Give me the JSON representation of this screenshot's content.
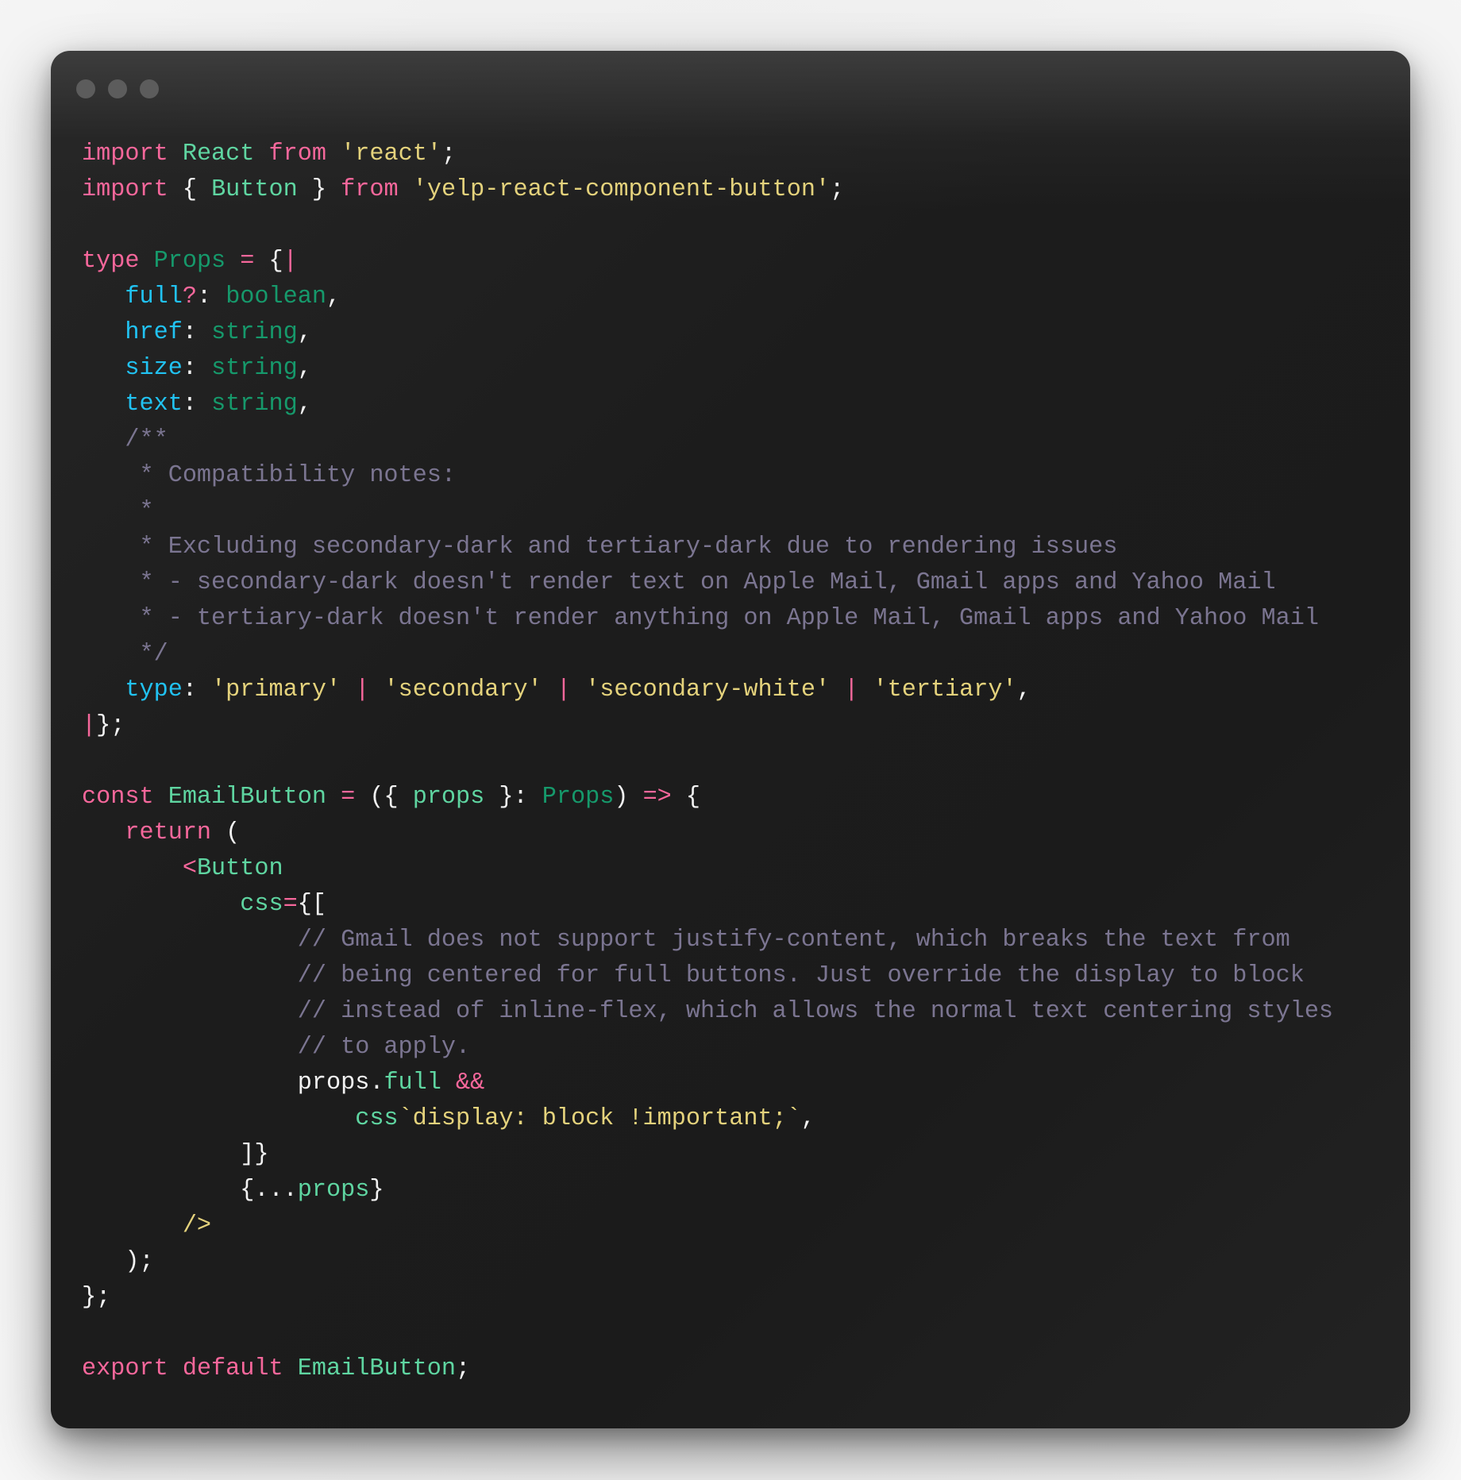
{
  "window": {
    "controls": [
      {
        "name": "close",
        "icon": "window-dot-icon"
      },
      {
        "name": "minimize",
        "icon": "window-dot-icon"
      },
      {
        "name": "zoom",
        "icon": "window-dot-icon"
      }
    ]
  },
  "colors": {
    "keyword": "#f6679b",
    "identifier": "#5fd5a1",
    "type": "#16996b",
    "string": "#e4d27c",
    "property": "#21c2f2",
    "comment": "#7b7591",
    "punctuation": "#f2f2f2",
    "window_background": "#1c1c1c"
  },
  "code": {
    "language": "javascript-flow-jsx",
    "lines": [
      {
        "indent": 0,
        "tokens": [
          [
            "import",
            "kw"
          ],
          [
            " ",
            "pn"
          ],
          [
            "React",
            "id"
          ],
          [
            " ",
            "pn"
          ],
          [
            "from",
            "kw"
          ],
          [
            " ",
            "pn"
          ],
          [
            "'react'",
            "str"
          ],
          [
            ";",
            "pn"
          ]
        ]
      },
      {
        "indent": 0,
        "tokens": [
          [
            "import",
            "kw"
          ],
          [
            " { ",
            "pn"
          ],
          [
            "Button",
            "id"
          ],
          [
            " } ",
            "pn"
          ],
          [
            "from",
            "kw"
          ],
          [
            " ",
            "pn"
          ],
          [
            "'yelp-react-component-button'",
            "str"
          ],
          [
            ";",
            "pn"
          ]
        ]
      },
      {
        "indent": 0,
        "tokens": []
      },
      {
        "indent": 0,
        "tokens": [
          [
            "type",
            "kw"
          ],
          [
            " ",
            "pn"
          ],
          [
            "Props",
            "ty"
          ],
          [
            " ",
            "pn"
          ],
          [
            "=",
            "kw"
          ],
          [
            " {",
            "pn"
          ],
          [
            "|",
            "pipe"
          ]
        ]
      },
      {
        "indent": 3,
        "tokens": [
          [
            "full",
            "prop"
          ],
          [
            "?",
            "kw"
          ],
          [
            ": ",
            "pn"
          ],
          [
            "boolean",
            "ty"
          ],
          [
            ",",
            "pn"
          ]
        ]
      },
      {
        "indent": 3,
        "tokens": [
          [
            "href",
            "prop"
          ],
          [
            ": ",
            "pn"
          ],
          [
            "string",
            "ty"
          ],
          [
            ",",
            "pn"
          ]
        ]
      },
      {
        "indent": 3,
        "tokens": [
          [
            "size",
            "prop"
          ],
          [
            ": ",
            "pn"
          ],
          [
            "string",
            "ty"
          ],
          [
            ",",
            "pn"
          ]
        ]
      },
      {
        "indent": 3,
        "tokens": [
          [
            "text",
            "prop"
          ],
          [
            ": ",
            "pn"
          ],
          [
            "string",
            "ty"
          ],
          [
            ",",
            "pn"
          ]
        ]
      },
      {
        "indent": 3,
        "tokens": [
          [
            "/**",
            "cm"
          ]
        ]
      },
      {
        "indent": 4,
        "tokens": [
          [
            "* Compatibility notes:",
            "cm"
          ]
        ]
      },
      {
        "indent": 4,
        "tokens": [
          [
            "*",
            "cm"
          ]
        ]
      },
      {
        "indent": 4,
        "tokens": [
          [
            "* Excluding secondary-dark and tertiary-dark due to rendering issues",
            "cm"
          ]
        ]
      },
      {
        "indent": 4,
        "tokens": [
          [
            "* - secondary-dark doesn't render text on Apple Mail, Gmail apps and Yahoo Mail",
            "cm"
          ]
        ]
      },
      {
        "indent": 4,
        "tokens": [
          [
            "* - tertiary-dark doesn't render anything on Apple Mail, Gmail apps and Yahoo Mail",
            "cm"
          ]
        ]
      },
      {
        "indent": 4,
        "tokens": [
          [
            "*/",
            "cm"
          ]
        ]
      },
      {
        "indent": 3,
        "tokens": [
          [
            "type",
            "prop"
          ],
          [
            ": ",
            "pn"
          ],
          [
            "'primary'",
            "str"
          ],
          [
            " ",
            "pn"
          ],
          [
            "|",
            "pipe"
          ],
          [
            " ",
            "pn"
          ],
          [
            "'secondary'",
            "str"
          ],
          [
            " ",
            "pn"
          ],
          [
            "|",
            "pipe"
          ],
          [
            " ",
            "pn"
          ],
          [
            "'secondary-white'",
            "str"
          ],
          [
            " ",
            "pn"
          ],
          [
            "|",
            "pipe"
          ],
          [
            " ",
            "pn"
          ],
          [
            "'tertiary'",
            "str"
          ],
          [
            ",",
            "pn"
          ]
        ]
      },
      {
        "indent": 0,
        "tokens": [
          [
            "|",
            "pipe"
          ],
          [
            "};",
            "pn"
          ]
        ]
      },
      {
        "indent": 0,
        "tokens": []
      },
      {
        "indent": 0,
        "tokens": [
          [
            "const",
            "kw"
          ],
          [
            " ",
            "pn"
          ],
          [
            "EmailButton",
            "id"
          ],
          [
            " ",
            "pn"
          ],
          [
            "=",
            "kw"
          ],
          [
            " ({ ",
            "pn"
          ],
          [
            "props",
            "id"
          ],
          [
            " }: ",
            "pn"
          ],
          [
            "Props",
            "ty"
          ],
          [
            ") ",
            "pn"
          ],
          [
            "=>",
            "kw"
          ],
          [
            " {",
            "pn"
          ]
        ]
      },
      {
        "indent": 3,
        "tokens": [
          [
            "return",
            "kw"
          ],
          [
            " (",
            "pn"
          ]
        ]
      },
      {
        "indent": 7,
        "tokens": [
          [
            "<",
            "kw"
          ],
          [
            "Button",
            "id"
          ]
        ]
      },
      {
        "indent": 11,
        "tokens": [
          [
            "css",
            "id"
          ],
          [
            "=",
            "kw"
          ],
          [
            "{[",
            "pn"
          ]
        ]
      },
      {
        "indent": 15,
        "tokens": [
          [
            "// Gmail does not support justify-content, which breaks the text from",
            "cm"
          ]
        ]
      },
      {
        "indent": 15,
        "tokens": [
          [
            "// being centered for full buttons. Just override the display to block",
            "cm"
          ]
        ]
      },
      {
        "indent": 15,
        "tokens": [
          [
            "// instead of inline-flex, which allows the normal text centering styles",
            "cm"
          ]
        ]
      },
      {
        "indent": 15,
        "tokens": [
          [
            "// to apply.",
            "cm"
          ]
        ]
      },
      {
        "indent": 15,
        "tokens": [
          [
            "props",
            "pn"
          ],
          [
            ".",
            "pn"
          ],
          [
            "full",
            "id"
          ],
          [
            " ",
            "pn"
          ],
          [
            "&&",
            "kw"
          ]
        ]
      },
      {
        "indent": 19,
        "tokens": [
          [
            "css",
            "id"
          ],
          [
            "`display: block !important;`",
            "str"
          ],
          [
            ",",
            "pn"
          ]
        ]
      },
      {
        "indent": 11,
        "tokens": [
          [
            "]}",
            "pn"
          ]
        ]
      },
      {
        "indent": 11,
        "tokens": [
          [
            "{...",
            "pn"
          ],
          [
            "props",
            "id"
          ],
          [
            "}",
            "pn"
          ]
        ]
      },
      {
        "indent": 7,
        "tokens": [
          [
            "/>",
            "str"
          ]
        ]
      },
      {
        "indent": 3,
        "tokens": [
          [
            ");",
            "pn"
          ]
        ]
      },
      {
        "indent": 0,
        "tokens": [
          [
            "};",
            "pn"
          ]
        ]
      },
      {
        "indent": 0,
        "tokens": []
      },
      {
        "indent": 0,
        "tokens": [
          [
            "export",
            "kw"
          ],
          [
            " ",
            "pn"
          ],
          [
            "default",
            "kw"
          ],
          [
            " ",
            "pn"
          ],
          [
            "EmailButton",
            "id"
          ],
          [
            ";",
            "pn"
          ]
        ]
      }
    ]
  }
}
